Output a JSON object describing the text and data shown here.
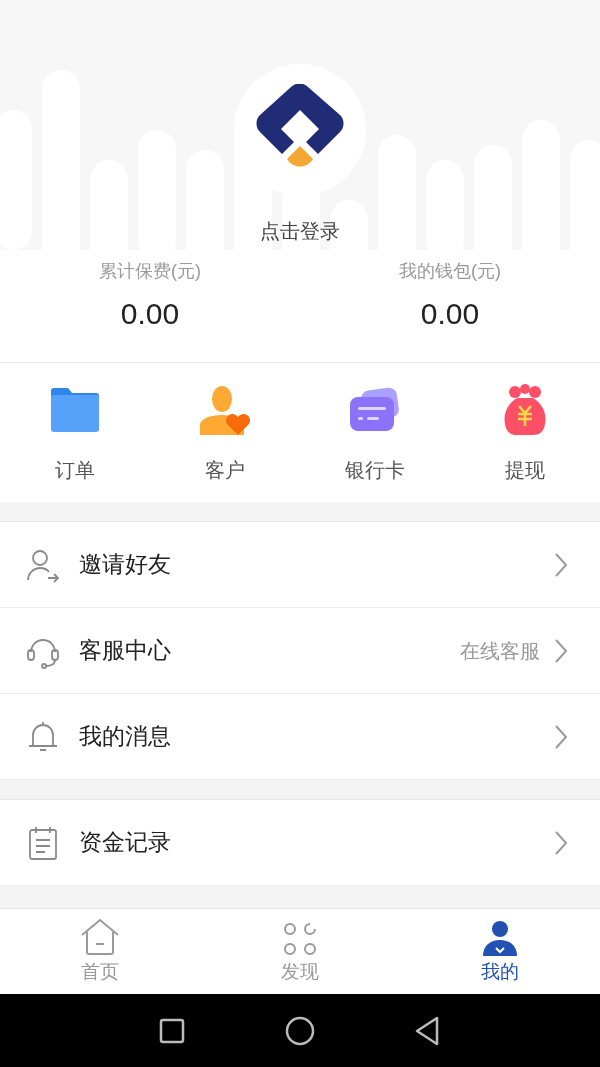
{
  "profile": {
    "login_label": "点击登录"
  },
  "stats": [
    {
      "label": "累计保费(元)",
      "value": "0.00"
    },
    {
      "label": "我的钱包(元)",
      "value": "0.00"
    }
  ],
  "shortcuts": [
    {
      "label": "订单"
    },
    {
      "label": "客户"
    },
    {
      "label": "银行卡"
    },
    {
      "label": "提现"
    }
  ],
  "menu_groups": [
    [
      {
        "label": "邀请好友"
      },
      {
        "label": "客服中心",
        "detail": "在线客服"
      },
      {
        "label": "我的消息"
      }
    ],
    [
      {
        "label": "资金记录"
      }
    ]
  ],
  "tabs": [
    {
      "label": "首页",
      "selected": false
    },
    {
      "label": "发现",
      "selected": false
    },
    {
      "label": "我的",
      "selected": true
    }
  ]
}
